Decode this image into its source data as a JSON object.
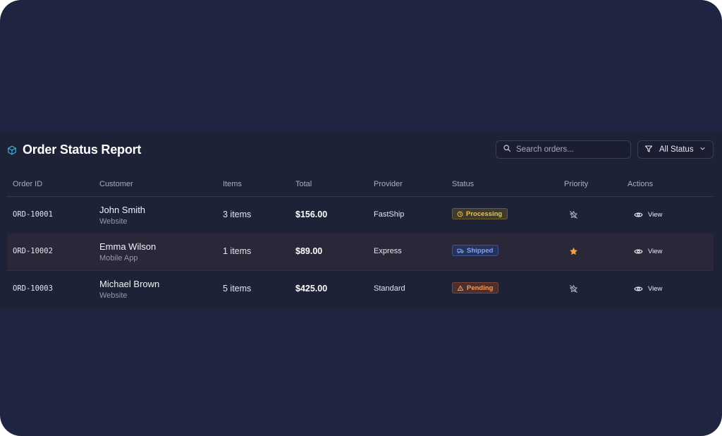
{
  "header": {
    "title": "Order Status Report",
    "search_placeholder": "Search orders...",
    "filter_label": "All Status"
  },
  "columns": [
    "Order ID",
    "Customer",
    "Items",
    "Total",
    "Provider",
    "Status",
    "Priority",
    "Actions"
  ],
  "orders": [
    {
      "id": "ORD-10001",
      "customer": "John Smith",
      "source": "Website",
      "items": "3 items",
      "total": "$156.00",
      "provider": "FastShip",
      "status": "Processing",
      "status_icon": "clock-icon",
      "priority": false,
      "action": "View"
    },
    {
      "id": "ORD-10002",
      "customer": "Emma Wilson",
      "source": "Mobile App",
      "items": "1 items",
      "total": "$89.00",
      "provider": "Express",
      "status": "Shipped",
      "status_icon": "truck-icon",
      "priority": true,
      "action": "View"
    },
    {
      "id": "ORD-10003",
      "customer": "Michael Brown",
      "source": "Website",
      "items": "5 items",
      "total": "$425.00",
      "provider": "Standard",
      "status": "Pending",
      "status_icon": "warning-icon",
      "priority": false,
      "action": "View"
    }
  ],
  "colors": {
    "background": "#1f2440",
    "panel": "#1e2236",
    "accent_icon": "#38b2d8",
    "processing": "#f0c14a",
    "shipped": "#7ea3ff",
    "pending": "#f59a5a",
    "priority_star": "#f5a142"
  }
}
